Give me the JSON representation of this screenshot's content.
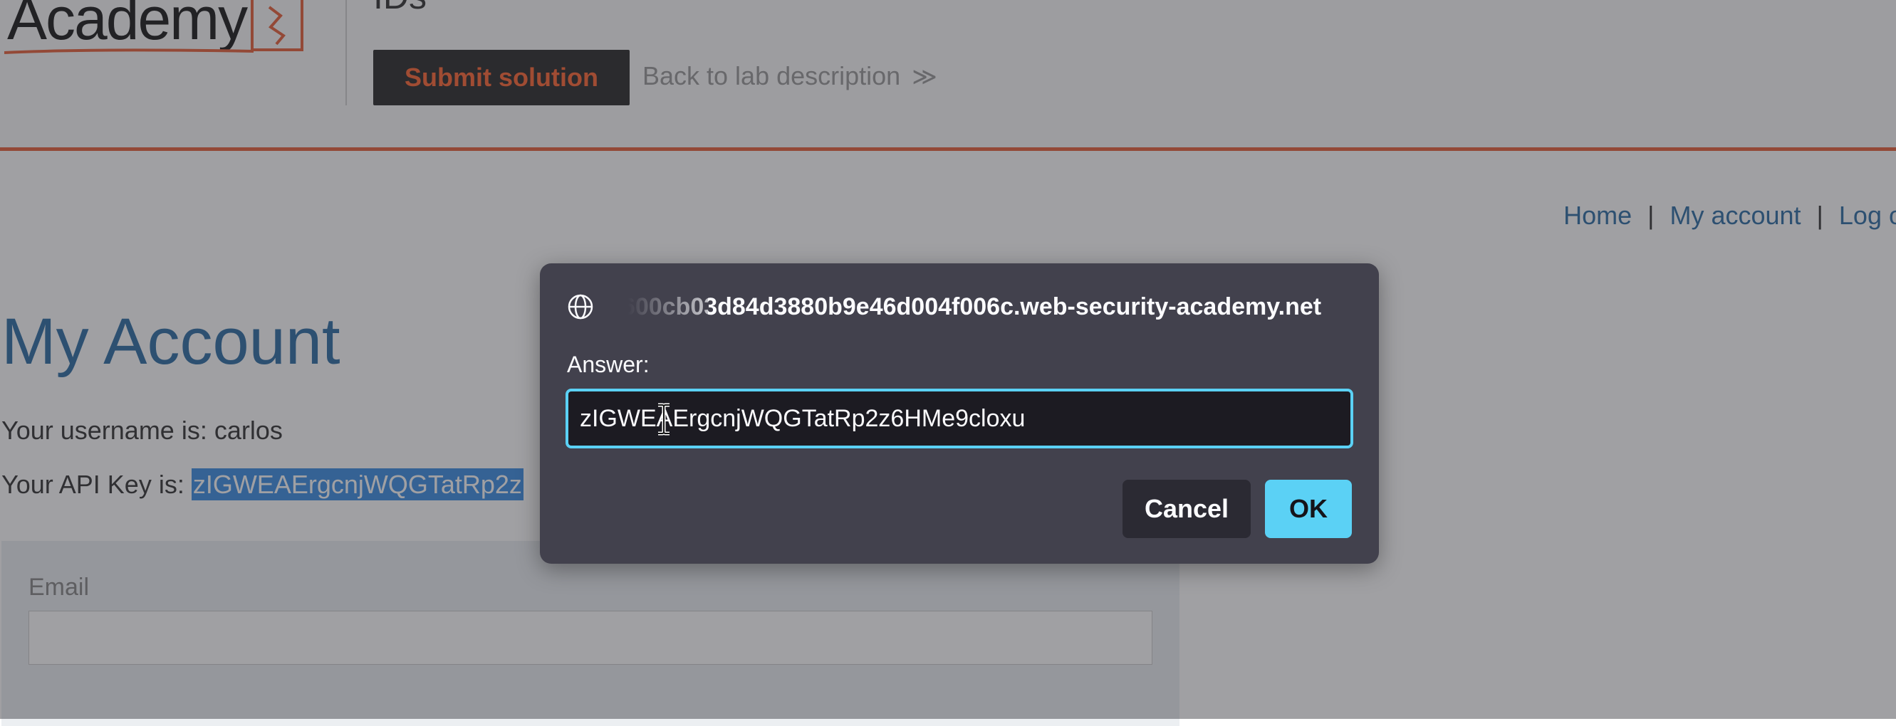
{
  "header": {
    "logo_text": "Academy",
    "lab_title_fragment": "IDs",
    "submit_label": "Submit solution",
    "back_label": "Back to lab description",
    "back_chevron": "≫"
  },
  "nav": {
    "items": [
      "Home",
      "My account",
      "Log o"
    ],
    "separator": "|"
  },
  "account": {
    "title": "My Account",
    "username_line": "Your username is: carlos",
    "apikey_prefix": "Your API Key is: ",
    "apikey_visible": "zIGWEAErgcnjWQGTatRp2z",
    "email_label": "Email",
    "email_value": ""
  },
  "dialog": {
    "origin": "9600cb03d84d3880b9e46d004f006c.web-security-academy.net",
    "answer_label": "Answer:",
    "answer_value": "zIGWEAErgcnjWQGTatRp2z6HMe9cloxu",
    "cancel_label": "Cancel",
    "ok_label": "OK"
  },
  "colors": {
    "accent_orange": "#e8623b",
    "link_blue": "#2e6da4",
    "dialog_bg": "#42414d",
    "dialog_accent": "#5bd1f5",
    "selection": "#3d8fe4"
  },
  "icons": {
    "globe": "globe-icon",
    "text_cursor": "ibeam-cursor-icon",
    "chevron": "double-chevron-right-icon"
  }
}
